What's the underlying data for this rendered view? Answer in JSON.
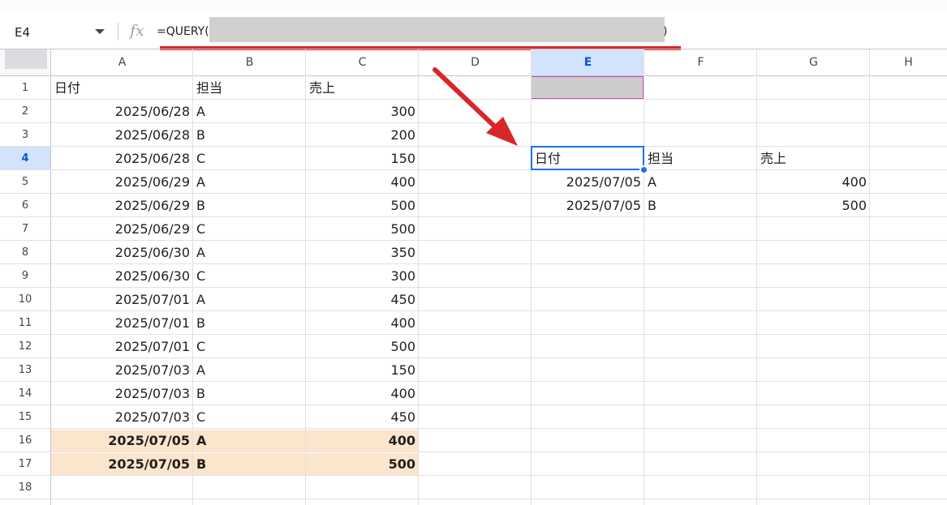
{
  "formula_bar": {
    "name_box": "E4",
    "fx_label": "fx",
    "formula_start": "=QUERY(",
    "formula_end": ")"
  },
  "columns": [
    "A",
    "B",
    "C",
    "D",
    "E",
    "F",
    "G",
    "H"
  ],
  "selected_column": "E",
  "rows": [
    "1",
    "2",
    "3",
    "4",
    "5",
    "6",
    "7",
    "8",
    "9",
    "10",
    "11",
    "12",
    "13",
    "14",
    "15",
    "16",
    "17",
    "18"
  ],
  "selected_row": "4",
  "source_table": {
    "headers": [
      "日付",
      "担当",
      "売上"
    ],
    "rows": [
      [
        "2025/06/28",
        "A",
        "300"
      ],
      [
        "2025/06/28",
        "B",
        "200"
      ],
      [
        "2025/06/28",
        "C",
        "150"
      ],
      [
        "2025/06/29",
        "A",
        "400"
      ],
      [
        "2025/06/29",
        "B",
        "500"
      ],
      [
        "2025/06/29",
        "C",
        "500"
      ],
      [
        "2025/06/30",
        "A",
        "350"
      ],
      [
        "2025/06/30",
        "C",
        "300"
      ],
      [
        "2025/07/01",
        "A",
        "450"
      ],
      [
        "2025/07/01",
        "B",
        "400"
      ],
      [
        "2025/07/01",
        "C",
        "500"
      ],
      [
        "2025/07/03",
        "A",
        "150"
      ],
      [
        "2025/07/03",
        "B",
        "400"
      ],
      [
        "2025/07/03",
        "C",
        "450"
      ],
      [
        "2025/07/05",
        "A",
        "400"
      ],
      [
        "2025/07/05",
        "B",
        "500"
      ]
    ],
    "highlighted_rows": [
      "16",
      "17"
    ]
  },
  "result_table": {
    "headers": [
      "日付",
      "担当",
      "売上"
    ],
    "rows": [
      [
        "2025/07/05",
        "A",
        "400"
      ],
      [
        "2025/07/05",
        "B",
        "500"
      ]
    ]
  },
  "colors": {
    "accent_red": "#d8262a",
    "selection_blue": "#1a73e8",
    "highlight_fill": "#fce5cd",
    "header_selected": "#d3e3fd",
    "redaction_gray": "#d0d0d0"
  }
}
